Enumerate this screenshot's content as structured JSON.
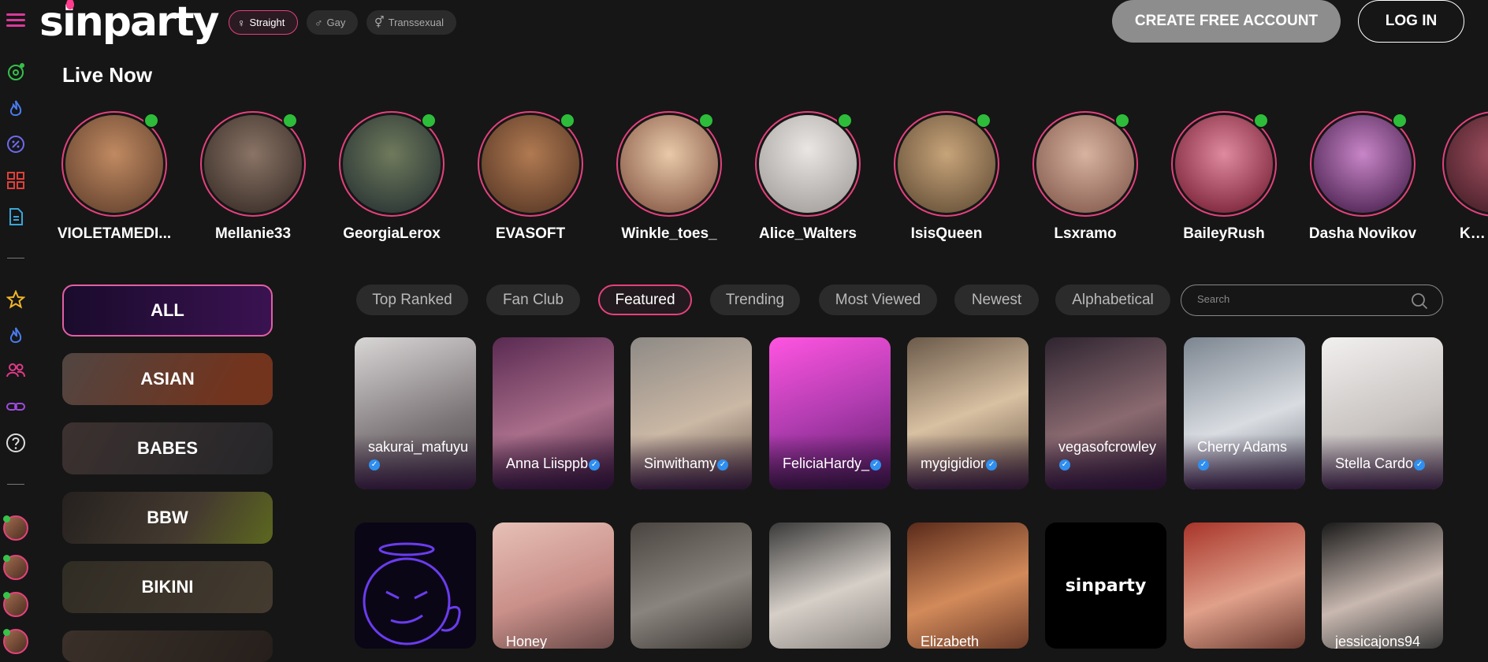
{
  "brand": {
    "logo_text": "sinparty",
    "accent": "#e5417d"
  },
  "filters": [
    {
      "label": "Straight",
      "icon": "female-icon",
      "active": true
    },
    {
      "label": "Gay",
      "icon": "male-icon",
      "active": false
    },
    {
      "label": "Transsexual",
      "icon": "trans-icon",
      "active": false
    }
  ],
  "header": {
    "create_label": "CREATE FREE ACCOUNT",
    "login_label": "LOG IN"
  },
  "live": {
    "title": "Live Now",
    "models": [
      {
        "name": "VIOLETAMEDI...",
        "color": "#8a5b3f"
      },
      {
        "name": "Mellanie33",
        "color": "#5a4a42"
      },
      {
        "name": "GeorgiaLerox",
        "color": "#3e4b2e"
      },
      {
        "name": "EVASOFT",
        "color": "#8a5a3b"
      },
      {
        "name": "Winkle_toes_",
        "color": "#c9a082"
      },
      {
        "name": "Alice_Walters",
        "color": "#cfcfcf"
      },
      {
        "name": "IsisQueen",
        "color": "#9a8060"
      },
      {
        "name": "Lsxramo",
        "color": "#b78a7b"
      },
      {
        "name": "BaileyRush",
        "color": "#a3213f"
      },
      {
        "name": "Dasha Novikov",
        "color": "#6a2a6e"
      },
      {
        "name": "Kelly",
        "color": "#7a3a4a"
      }
    ]
  },
  "categories": [
    "ALL",
    "ASIAN",
    "BABES",
    "BBW",
    "BIKINI"
  ],
  "tabs": [
    "Top Ranked",
    "Fan Club",
    "Featured",
    "Trending",
    "Most Viewed",
    "Newest",
    "Alphabetical"
  ],
  "active_tab": "Featured",
  "search": {
    "placeholder": "Search"
  },
  "cards": [
    {
      "name": "sakurai_mafuyu",
      "color": "#a4a1a3"
    },
    {
      "name": "Anna Liisppb",
      "color": "#7b3d66"
    },
    {
      "name": "Sinwithamy",
      "color": "#9b8a7c"
    },
    {
      "name": "FeliciaHardy_",
      "color": "#b33fb3"
    },
    {
      "name": "mygigidior",
      "color": "#8f7a63"
    },
    {
      "name": "vegasofcrowley",
      "color": "#3e3040"
    },
    {
      "name": "Cherry Adams",
      "color": "#9fa6ad"
    },
    {
      "name": "Stella Cardo",
      "color": "#d6d4d4"
    }
  ],
  "cards_row2": [
    {
      "name": "",
      "color": "#0b0616"
    },
    {
      "name": "Honey",
      "color": "#c98f89"
    },
    {
      "name": "",
      "color": "#6a6560"
    },
    {
      "name": "",
      "color": "#9a9796"
    },
    {
      "name": "Elizabeth",
      "color": "#7a3b2b"
    },
    {
      "name": "sinparty",
      "color": "#000000"
    },
    {
      "name": "",
      "color": "#c4685a"
    },
    {
      "name": "jessicajons94",
      "color": "#4a4a4a"
    }
  ]
}
